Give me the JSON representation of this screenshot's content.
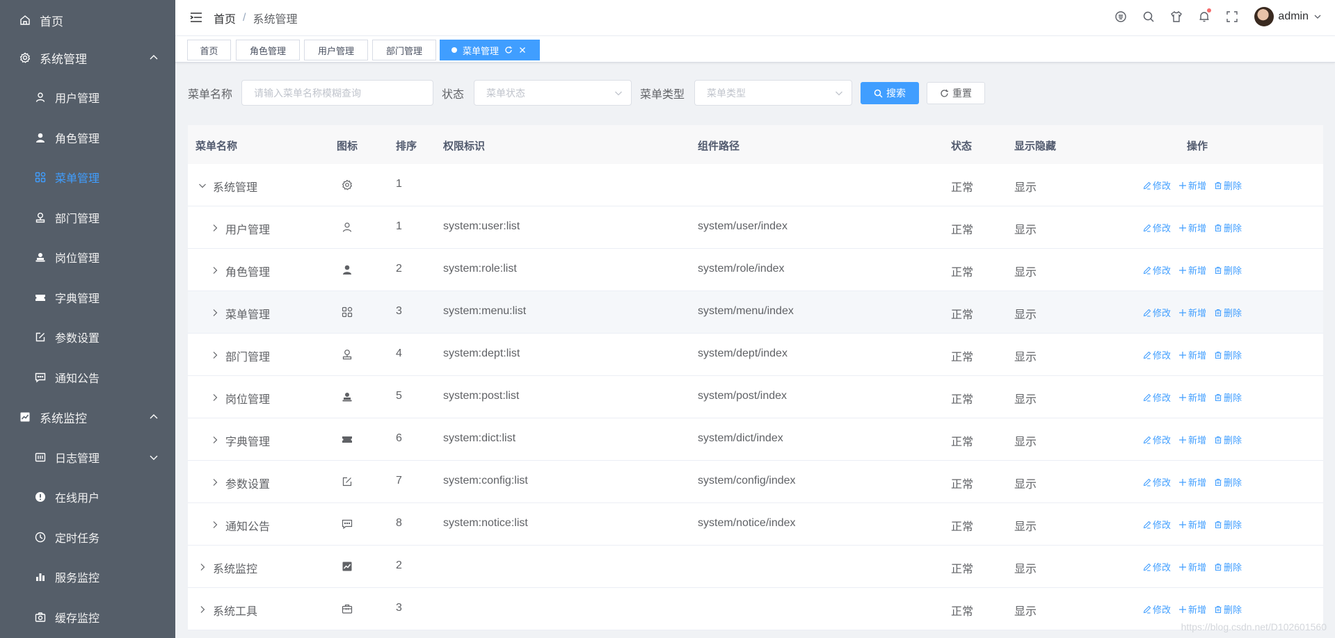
{
  "sidebar": {
    "home": "首页",
    "sys_manage": "系统管理",
    "user_manage": "用户管理",
    "role_manage": "角色管理",
    "menu_manage": "菜单管理",
    "dept_manage": "部门管理",
    "post_manage": "岗位管理",
    "dict_manage": "字典管理",
    "config_manage": "参数设置",
    "notice_manage": "通知公告",
    "monitor": "系统监控",
    "log_manage": "日志管理",
    "online_user": "在线用户",
    "job": "定时任务",
    "server": "服务监控",
    "cache": "缓存监控"
  },
  "header": {
    "breadcrumb_home": "首页",
    "breadcrumb_sep": "/",
    "breadcrumb_current": "系统管理",
    "username": "admin"
  },
  "tags": {
    "home": "首页",
    "role": "角色管理",
    "user": "用户管理",
    "dept": "部门管理",
    "menu": "菜单管理"
  },
  "search": {
    "menu_name_label": "菜单名称",
    "menu_name_placeholder": "请输入菜单名称模糊查询",
    "status_label": "状态",
    "status_placeholder": "菜单状态",
    "type_label": "菜单类型",
    "type_placeholder": "菜单类型",
    "search_btn": "搜索",
    "reset_btn": "重置"
  },
  "table": {
    "headers": {
      "name": "菜单名称",
      "icon": "图标",
      "order": "排序",
      "perms": "权限标识",
      "component": "组件路径",
      "status": "状态",
      "visible": "显示隐藏",
      "ops": "操作"
    },
    "ops": {
      "edit": "修改",
      "add": "新增",
      "delete": "删除"
    },
    "rows": [
      {
        "name": "系统管理",
        "icon": "gear-icon",
        "order": "1",
        "perms": "",
        "component": "",
        "status": "正常",
        "visible": "显示",
        "level": 0,
        "expanded": true
      },
      {
        "name": "用户管理",
        "icon": "user-outline-icon",
        "order": "1",
        "perms": "system:user:list",
        "component": "system/user/index",
        "status": "正常",
        "visible": "显示",
        "level": 1,
        "expanded": false
      },
      {
        "name": "角色管理",
        "icon": "user-solid-icon",
        "order": "2",
        "perms": "system:role:list",
        "component": "system/role/index",
        "status": "正常",
        "visible": "显示",
        "level": 1,
        "expanded": false
      },
      {
        "name": "菜单管理",
        "icon": "grid-icon",
        "order": "3",
        "perms": "system:menu:list",
        "component": "system/menu/index",
        "status": "正常",
        "visible": "显示",
        "level": 1,
        "expanded": false
      },
      {
        "name": "部门管理",
        "icon": "dept-icon",
        "order": "4",
        "perms": "system:dept:list",
        "component": "system/dept/index",
        "status": "正常",
        "visible": "显示",
        "level": 1,
        "expanded": false
      },
      {
        "name": "岗位管理",
        "icon": "post-icon",
        "order": "5",
        "perms": "system:post:list",
        "component": "system/post/index",
        "status": "正常",
        "visible": "显示",
        "level": 1,
        "expanded": false
      },
      {
        "name": "字典管理",
        "icon": "ticket-icon",
        "order": "6",
        "perms": "system:dict:list",
        "component": "system/dict/index",
        "status": "正常",
        "visible": "显示",
        "level": 1,
        "expanded": false
      },
      {
        "name": "参数设置",
        "icon": "edit-icon",
        "order": "7",
        "perms": "system:config:list",
        "component": "system/config/index",
        "status": "正常",
        "visible": "显示",
        "level": 1,
        "expanded": false
      },
      {
        "name": "通知公告",
        "icon": "message-icon",
        "order": "8",
        "perms": "system:notice:list",
        "component": "system/notice/index",
        "status": "正常",
        "visible": "显示",
        "level": 1,
        "expanded": false
      },
      {
        "name": "系统监控",
        "icon": "monitor-icon",
        "order": "2",
        "perms": "",
        "component": "",
        "status": "正常",
        "visible": "显示",
        "level": 0,
        "expanded": false
      },
      {
        "name": "系统工具",
        "icon": "toolbox-icon",
        "order": "3",
        "perms": "",
        "component": "",
        "status": "正常",
        "visible": "显示",
        "level": 0,
        "expanded": false
      }
    ]
  },
  "watermark": "https://blog.csdn.net/D102601560",
  "colors": {
    "sidebar_bg": "#555e69",
    "accent": "#409eff",
    "header_bg": "#ffffff",
    "text_main": "#606266"
  }
}
